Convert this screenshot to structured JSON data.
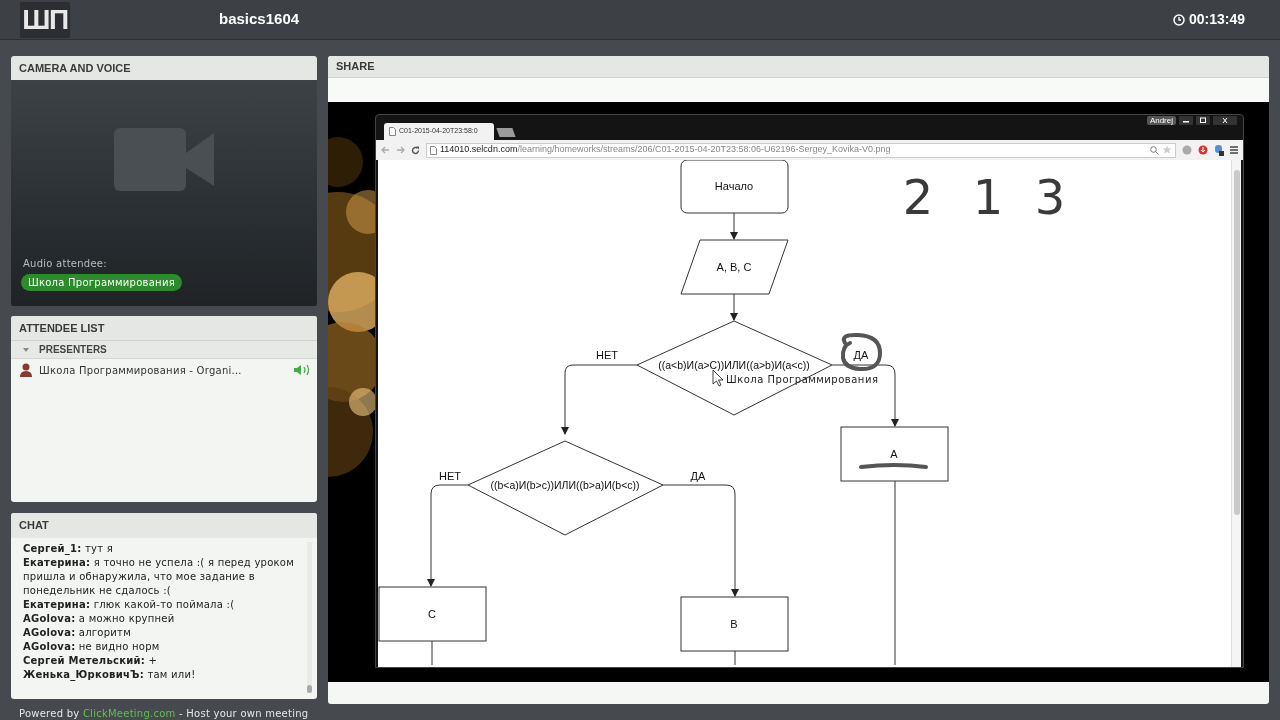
{
  "header": {
    "logo": "ШП",
    "title": "basics1604",
    "timer": "00:13:49"
  },
  "camera_panel": {
    "title": "CAMERA AND VOICE",
    "audio_label": "Audio attendee:",
    "audio_attendee": "Школа Программирования"
  },
  "attendee_panel": {
    "title": "ATTENDEE LIST",
    "groups": [
      {
        "label": "PRESENTERS",
        "expanded": true,
        "attendees": [
          {
            "name": "Школа Программирования - Organi...",
            "speaking": true
          }
        ]
      }
    ]
  },
  "chat_panel": {
    "title": "CHAT",
    "messages": [
      {
        "author": "Сергей_1:",
        "text": "тут я"
      },
      {
        "author": "Екатерина:",
        "text": "я точно не успела :( я перед уроком пришла и обнаружила, что мое задание в понедельник не сдалось :("
      },
      {
        "author": "Екатерина:",
        "text": "глюк какой-то поймала :("
      },
      {
        "author": "AGolova:",
        "text": "а можно крупней"
      },
      {
        "author": "AGolova:",
        "text": "алгоритм"
      },
      {
        "author": "AGolova:",
        "text": "не видно норм"
      },
      {
        "author": "Сергей Метельский:",
        "text": "+"
      },
      {
        "author": "Женька_ЮрковичЪ:",
        "text": "там или!"
      }
    ]
  },
  "footer": {
    "prefix": "Powered by",
    "link": "ClickMeeting.com",
    "suffix": "- Host your own meeting"
  },
  "share_panel": {
    "title": "SHARE",
    "browser": {
      "user": "Andrej",
      "tab_title": "C01-2015-04-20T23:58:0",
      "url_host": "114010.selcdn.com",
      "url_path": "/learning/homeworks/streams/206/C01-2015-04-20T23:58:06-U62196-Sergey_Kovika-V0.png",
      "flowchart": {
        "nodes": [
          {
            "kind": "terminal",
            "text": "Начало"
          },
          {
            "kind": "io",
            "text": "A, B, C"
          },
          {
            "kind": "decision",
            "text": "((a<b)И(a>C))ИЛИ((a>b)И(a<c))"
          },
          {
            "kind": "process",
            "text": "A"
          },
          {
            "kind": "decision",
            "text": "((b<a)И(b>c))ИЛИ((b>a)И(b<c))"
          },
          {
            "kind": "process",
            "text": "C"
          },
          {
            "kind": "process",
            "text": "B"
          }
        ],
        "edge_labels": [
          "НЕТ",
          "ДА",
          "НЕТ",
          "ДА"
        ],
        "handwriting": [
          "2",
          "1",
          "3"
        ]
      },
      "pointer_label": "Школа Программирования"
    }
  }
}
